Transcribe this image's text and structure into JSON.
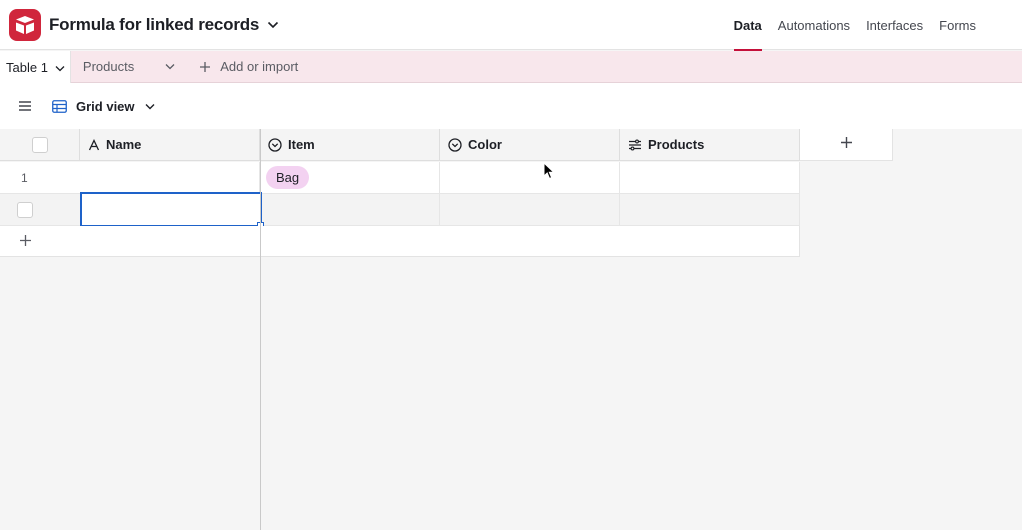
{
  "base": {
    "title": "Formula for linked records"
  },
  "nav": {
    "items": [
      {
        "label": "Data",
        "active": true
      },
      {
        "label": "Automations",
        "active": false
      },
      {
        "label": "Interfaces",
        "active": false
      },
      {
        "label": "Forms",
        "active": false
      }
    ]
  },
  "tabs": {
    "active": "Table 1",
    "other": "Products",
    "add_import": "Add or import"
  },
  "view": {
    "name": "Grid view"
  },
  "grid": {
    "columns": [
      {
        "label": "Name",
        "icon": "text-icon"
      },
      {
        "label": "Item",
        "icon": "single-select-icon"
      },
      {
        "label": "Color",
        "icon": "single-select-icon"
      },
      {
        "label": "Products",
        "icon": "lookup-icon"
      }
    ],
    "rows": [
      {
        "number": "1",
        "name": "",
        "item": "Bag",
        "color": "",
        "products": ""
      },
      {
        "number": "",
        "name": "",
        "item": "",
        "color": "",
        "products": ""
      }
    ]
  },
  "colors": {
    "brand": "#d0263c",
    "accent": "#c4103a",
    "selection": "#1e62c9",
    "pill": "#f3d2f1"
  }
}
